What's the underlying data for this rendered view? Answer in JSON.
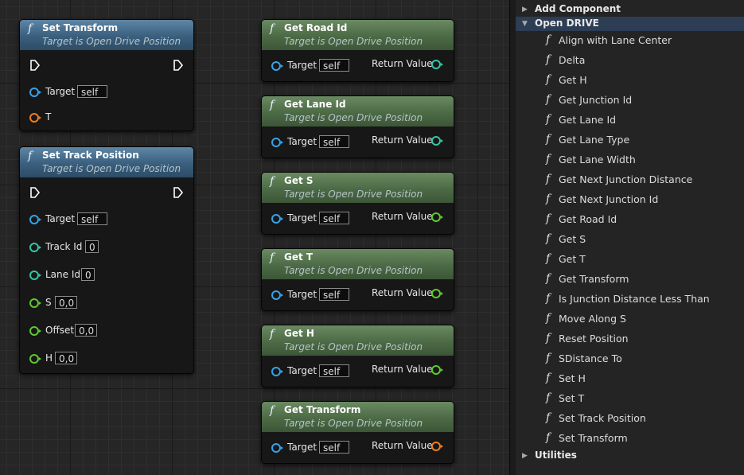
{
  "graph": {
    "nodes": [
      {
        "id": "set-transform",
        "title": "Set Transform",
        "subtitle": "Target is Open Drive Position",
        "color": "blue",
        "exec": true,
        "pins": [
          {
            "label": "Target",
            "value": "self",
            "color": "blue"
          },
          {
            "label": "T",
            "value": "",
            "color": "orange"
          }
        ]
      },
      {
        "id": "set-track-position",
        "title": "Set Track Position",
        "subtitle": "Target is Open Drive Position",
        "color": "blue",
        "exec": true,
        "pins": [
          {
            "label": "Target",
            "value": "self",
            "color": "blue"
          },
          {
            "label": "Track Id",
            "value": "0",
            "color": "teal"
          },
          {
            "label": "Lane Id",
            "value": "0",
            "color": "teal"
          },
          {
            "label": "S",
            "value": "0,0",
            "color": "green"
          },
          {
            "label": "Offset",
            "value": "0,0",
            "color": "green"
          },
          {
            "label": "H",
            "value": "0,0",
            "color": "green"
          }
        ]
      },
      {
        "id": "get-road-id",
        "title": "Get Road Id",
        "subtitle": "Target is Open Drive Position",
        "color": "green",
        "target": "Target",
        "target_value": "self",
        "return": "Return Value",
        "return_color": "teal"
      },
      {
        "id": "get-lane-id",
        "title": "Get Lane Id",
        "subtitle": "Target is Open Drive Position",
        "color": "green",
        "target": "Target",
        "target_value": "self",
        "return": "Return Value",
        "return_color": "teal"
      },
      {
        "id": "get-s",
        "title": "Get S",
        "subtitle": "Target is Open Drive Position",
        "color": "green",
        "target": "Target",
        "target_value": "self",
        "return": "Return Value",
        "return_color": "green"
      },
      {
        "id": "get-t",
        "title": "Get T",
        "subtitle": "Target is Open Drive Position",
        "color": "green",
        "target": "Target",
        "target_value": "self",
        "return": "Return Value",
        "return_color": "green"
      },
      {
        "id": "get-h",
        "title": "Get H",
        "subtitle": "Target is Open Drive Position",
        "color": "green",
        "target": "Target",
        "target_value": "self",
        "return": "Return Value",
        "return_color": "green"
      },
      {
        "id": "get-transform",
        "title": "Get Transform",
        "subtitle": "Target is Open Drive Position",
        "color": "green",
        "target": "Target",
        "target_value": "self",
        "return": "Return Value",
        "return_color": "orange"
      }
    ]
  },
  "panel": {
    "categories": [
      {
        "label": "Add Component",
        "expanded": false
      },
      {
        "label": "Open DRIVE",
        "expanded": true
      },
      {
        "label": "Utilities",
        "expanded": false
      }
    ],
    "function_glyph": "f",
    "items": [
      "Align with Lane Center",
      "Delta",
      "Get H",
      "Get Junction Id",
      "Get Lane Id",
      "Get Lane Type",
      "Get Lane Width",
      "Get Next Junction Distance",
      "Get Next Junction Id",
      "Get Road Id",
      "Get S",
      "Get T",
      "Get Transform",
      "Is Junction Distance Less Than",
      "Move Along S",
      "Reset Position",
      "SDistance To",
      "Set H",
      "Set T",
      "Set Track Position",
      "Set Transform"
    ]
  },
  "colors": {
    "pin_blue": "#35a3ea",
    "pin_teal": "#36c4a5",
    "pin_green": "#5ec92e",
    "pin_orange": "#f07d1e"
  }
}
